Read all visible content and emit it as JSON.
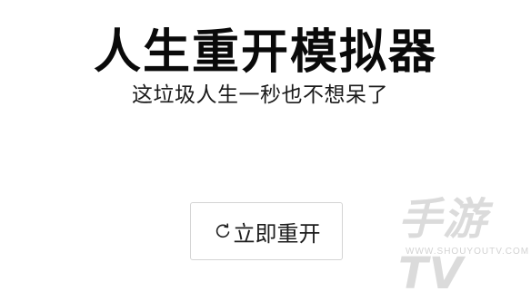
{
  "header": {
    "title": "人生重开模拟器",
    "subtitle": "这垃圾人生一秒也不想呆了"
  },
  "actions": {
    "restart_label": "立即重开",
    "restart_icon": "refresh-icon"
  },
  "watermark": {
    "brand": "手游TV",
    "url": "WWW.SHOUYOUTV.COM"
  }
}
